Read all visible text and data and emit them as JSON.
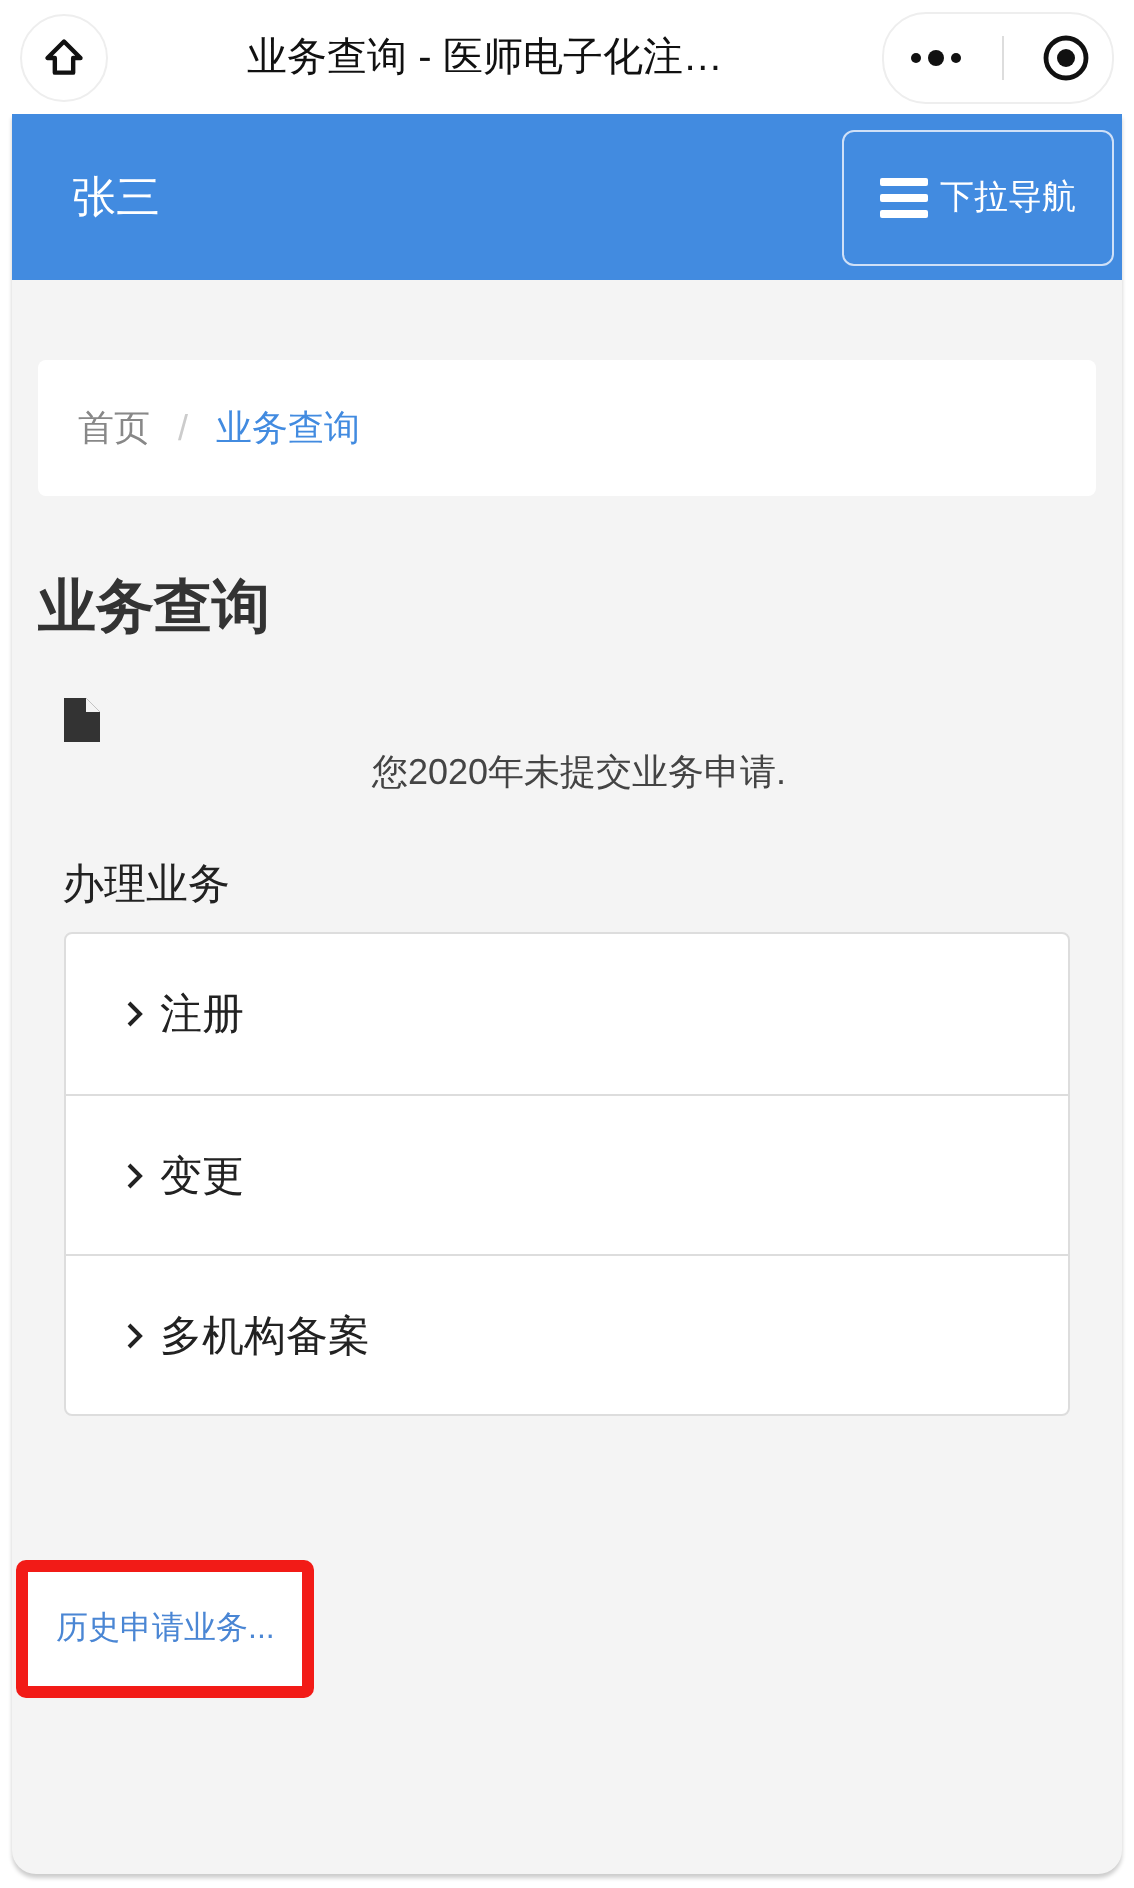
{
  "capsule_bar": {
    "title": "业务查询 - 医师电子化注…"
  },
  "header": {
    "user": "张三",
    "menu_button": "下拉导航"
  },
  "breadcrumb_separator": "/",
  "breadcrumb": [
    {
      "label": "首页",
      "selected": false
    },
    {
      "label": "业务查询",
      "selected": true
    }
  ],
  "page_title": "业务查询",
  "notice": "您2020年未提交业务申请.",
  "section_title": "办理业务",
  "services": [
    {
      "label": "注册"
    },
    {
      "label": "变更"
    },
    {
      "label": "多机构备案"
    }
  ],
  "history_link": {
    "label": "历史申请业务...",
    "highlighted": true
  }
}
